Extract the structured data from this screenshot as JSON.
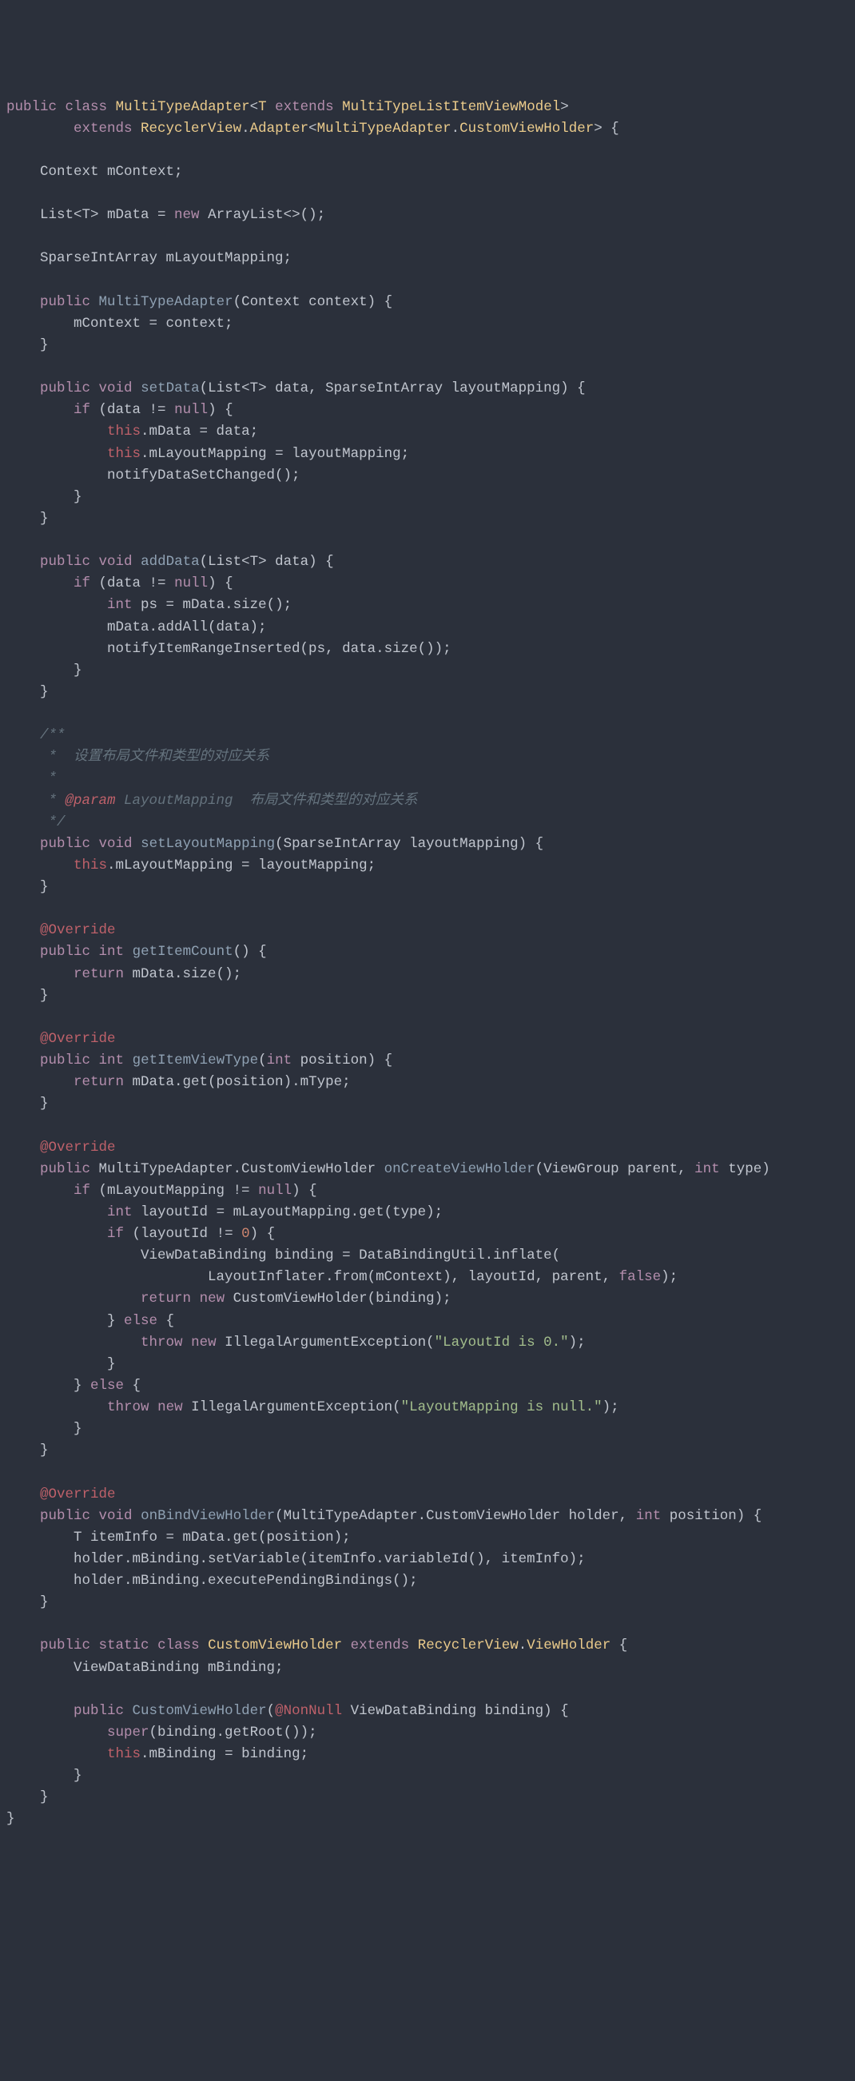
{
  "code": {
    "l1": {
      "kw1": "public",
      "kw2": "class",
      "cls": "MultiTypeAdapter",
      "lt": "<",
      "tp": "T",
      "kw3": "extends",
      "cls2": "MultiTypeListItemViewModel",
      "gt": ">"
    },
    "l2": {
      "kw1": "extends",
      "cls1": "RecyclerView",
      "dot": ".",
      "cls2": "Adapter",
      "lt": "<",
      "cls3": "MultiTypeAdapter",
      "dot2": ".",
      "cls4": "CustomViewHolder",
      "gt": ">",
      "brace": " {"
    },
    "l4": "    Context mContext;",
    "l6": {
      "pre": "    List<T> mData = ",
      "kw": "new",
      "post": " ArrayList<>();"
    },
    "l8": "    SparseIntArray mLayoutMapping;",
    "l10": {
      "kw1": "public",
      "fn": "MultiTypeAdapter",
      "args": "(Context context) {"
    },
    "l11": "        mContext = context;",
    "l12": "    }",
    "l14": {
      "kw1": "public",
      "kw2": "void",
      "fn": "setData",
      "args": "(List<T> data, SparseIntArray layoutMapping) {"
    },
    "l15": {
      "kw": "if",
      "cond": " (data != ",
      "null": "null",
      "post": ") {"
    },
    "l16": {
      "pre": "            ",
      "this": "this",
      "post": ".mData = data;"
    },
    "l17": {
      "pre": "            ",
      "this": "this",
      "post": ".mLayoutMapping = layoutMapping;"
    },
    "l18": "            notifyDataSetChanged();",
    "l19": "        }",
    "l20": "    }",
    "l22": {
      "kw1": "public",
      "kw2": "void",
      "fn": "addData",
      "args": "(List<T> data) {"
    },
    "l23": {
      "kw": "if",
      "cond": " (data != ",
      "null": "null",
      "post": ") {"
    },
    "l24": {
      "pre": "            ",
      "kw": "int",
      "post": " ps = mData.size();"
    },
    "l25": "            mData.addAll(data);",
    "l26": "            notifyItemRangeInserted(ps, data.size());",
    "l27": "        }",
    "l28": "    }",
    "c1": "    /**",
    "c2": "     *  设置布局文件和类型的对应关系",
    "c3": "     *",
    "c4a": "     * ",
    "c4ann": "@param",
    "c4b": " LayoutMapping  布局文件和类型的对应关系",
    "c5": "     */",
    "l31": {
      "kw1": "public",
      "kw2": "void",
      "fn": "setLayoutMapping",
      "args": "(SparseIntArray layoutMapping) {"
    },
    "l32": {
      "pre": "        ",
      "this": "this",
      "post": ".mLayoutMapping = layoutMapping;"
    },
    "l33": "    }",
    "ov": "@Override",
    "l36": {
      "kw1": "public",
      "kw2": "int",
      "fn": "getItemCount",
      "args": "() {"
    },
    "l37": {
      "kw": "return",
      "post": " mData.size();"
    },
    "l38": "    }",
    "l41": {
      "kw1": "public",
      "kw2": "int",
      "fn": "getItemViewType",
      "args": "(",
      "kw3": "int",
      "args2": " position) {"
    },
    "l42": {
      "kw": "return",
      "post": " mData.get(position).mType;"
    },
    "l43": "    }",
    "l46": {
      "kw1": "public",
      "post1": " MultiTypeAdapter.CustomViewHolder ",
      "fn": "onCreateViewHolder",
      "args1": "(ViewGroup parent, ",
      "kw2": "int",
      "args2": " type)"
    },
    "l47": {
      "kw": "if",
      "cond": " (mLayoutMapping != ",
      "null": "null",
      "post": ") {"
    },
    "l48": {
      "pre": "            ",
      "kw": "int",
      "post": " layoutId = mLayoutMapping.get(type);"
    },
    "l49": {
      "kw": "if",
      "cond": " (layoutId != ",
      "num": "0",
      "post": ") {"
    },
    "l50": "                ViewDataBinding binding = DataBindingUtil.inflate(",
    "l51": {
      "pre": "                        LayoutInflater.from(mContext), layoutId, parent, ",
      "kw": "false",
      "post": ");"
    },
    "l52": {
      "kw": "return",
      "kw2": "new",
      "post": " CustomViewHolder(binding);"
    },
    "l53": {
      "pre": "            } ",
      "kw": "else",
      "post": " {"
    },
    "l54": {
      "kw1": "throw",
      "kw2": "new",
      "post": " IllegalArgumentException(",
      "str": "\"LayoutId is 0.\"",
      "post2": ");"
    },
    "l55": "            }",
    "l56": {
      "pre": "        } ",
      "kw": "else",
      "post": " {"
    },
    "l57": {
      "kw1": "throw",
      "kw2": "new",
      "post": " IllegalArgumentException(",
      "str": "\"LayoutMapping is null.\"",
      "post2": ");"
    },
    "l58": "        }",
    "l59": "    }",
    "l62": {
      "kw1": "public",
      "kw2": "void",
      "fn": "onBindViewHolder",
      "args1": "(MultiTypeAdapter.CustomViewHolder holder, ",
      "kw3": "int",
      "args2": " position) {"
    },
    "l63": "        T itemInfo = mData.get(position);",
    "l64": "        holder.mBinding.setVariable(itemInfo.variableId(), itemInfo);",
    "l65": "        holder.mBinding.executePendingBindings();",
    "l66": "    }",
    "l68": {
      "kw1": "public",
      "kw2": "static",
      "kw3": "class",
      "cls1": "CustomViewHolder",
      "kw4": "extends",
      "cls2": "RecyclerView",
      "dot": ".",
      "cls3": "ViewHolder",
      "brace": " {"
    },
    "l69": "        ViewDataBinding mBinding;",
    "l71": {
      "kw1": "public",
      "fn": "CustomViewHolder",
      "args1": "(",
      "ann": "@NonNull",
      "args2": " ViewDataBinding binding) {"
    },
    "l72": {
      "kw": "super",
      "post": "(binding.getRoot());"
    },
    "l73": {
      "pre": "            ",
      "this": "this",
      "post": ".mBinding = binding;"
    },
    "l74": "        }",
    "l75": "    }",
    "l76": "}"
  }
}
